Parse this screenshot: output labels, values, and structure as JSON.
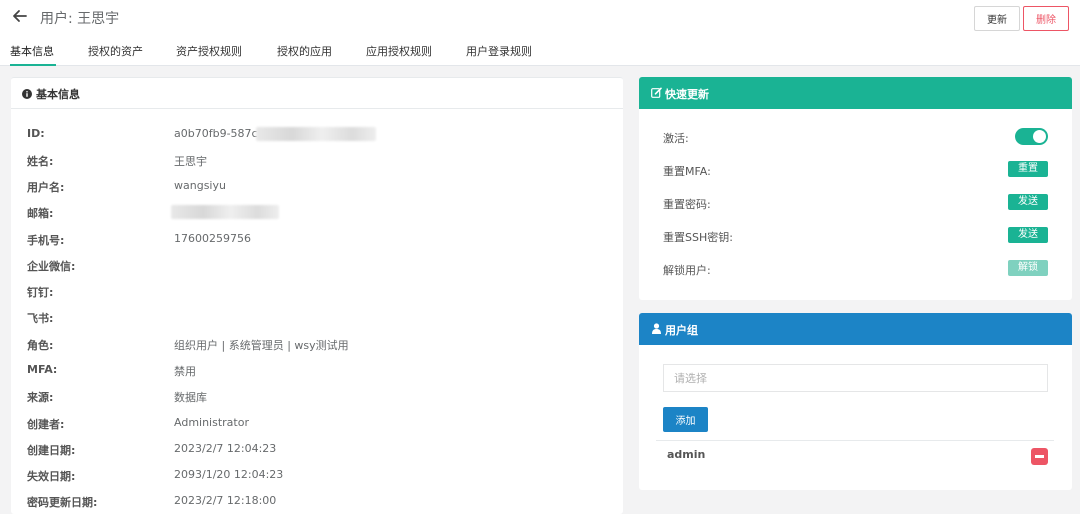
{
  "header": {
    "title": "用户: 王思宇",
    "update_label": "更新",
    "delete_label": "删除"
  },
  "tabs": [
    {
      "label": "基本信息"
    },
    {
      "label": "授权的资产"
    },
    {
      "label": "资产授权规则"
    },
    {
      "label": "授权的应用"
    },
    {
      "label": "应用授权规则"
    },
    {
      "label": "用户登录规则"
    }
  ],
  "basic_info": {
    "title": "基本信息",
    "rows": [
      {
        "label": "ID:",
        "value": "a0b70fb9-587c-4"
      },
      {
        "label": "姓名:",
        "value": "王思宇"
      },
      {
        "label": "用户名:",
        "value": "wangsiyu"
      },
      {
        "label": "邮箱:",
        "value": ""
      },
      {
        "label": "手机号:",
        "value": "17600259756"
      },
      {
        "label": "企业微信:",
        "value": ""
      },
      {
        "label": "钉钉:",
        "value": ""
      },
      {
        "label": "飞书:",
        "value": ""
      },
      {
        "label": "角色:",
        "value": "组织用户 | 系统管理员 | wsy测试用"
      },
      {
        "label": "MFA:",
        "value": "禁用"
      },
      {
        "label": "来源:",
        "value": "数据库"
      },
      {
        "label": "创建者:",
        "value": "Administrator"
      },
      {
        "label": "创建日期:",
        "value": "2023/2/7 12:04:23"
      },
      {
        "label": "失效日期:",
        "value": "2093/1/20 12:04:23"
      },
      {
        "label": "密码更新日期:",
        "value": "2023/2/7 12:18:00"
      }
    ]
  },
  "quick_update": {
    "title": "快速更新",
    "activate_label": "激活:",
    "activate_on": true,
    "reset_mfa_label": "重置MFA:",
    "reset_mfa_btn": "重置",
    "reset_password_label": "重置密码:",
    "reset_password_btn": "发送",
    "reset_ssh_label": "重置SSH密钥:",
    "reset_ssh_btn": "发送",
    "unlock_label": "解锁用户:",
    "unlock_btn": "解锁"
  },
  "user_group": {
    "title": "用户组",
    "placeholder": "请选择",
    "add_label": "添加",
    "groups": [
      {
        "name": "admin"
      }
    ]
  },
  "colors": {
    "primary": "#1ab394",
    "info": "#1c84c6",
    "danger": "#ed5565"
  }
}
